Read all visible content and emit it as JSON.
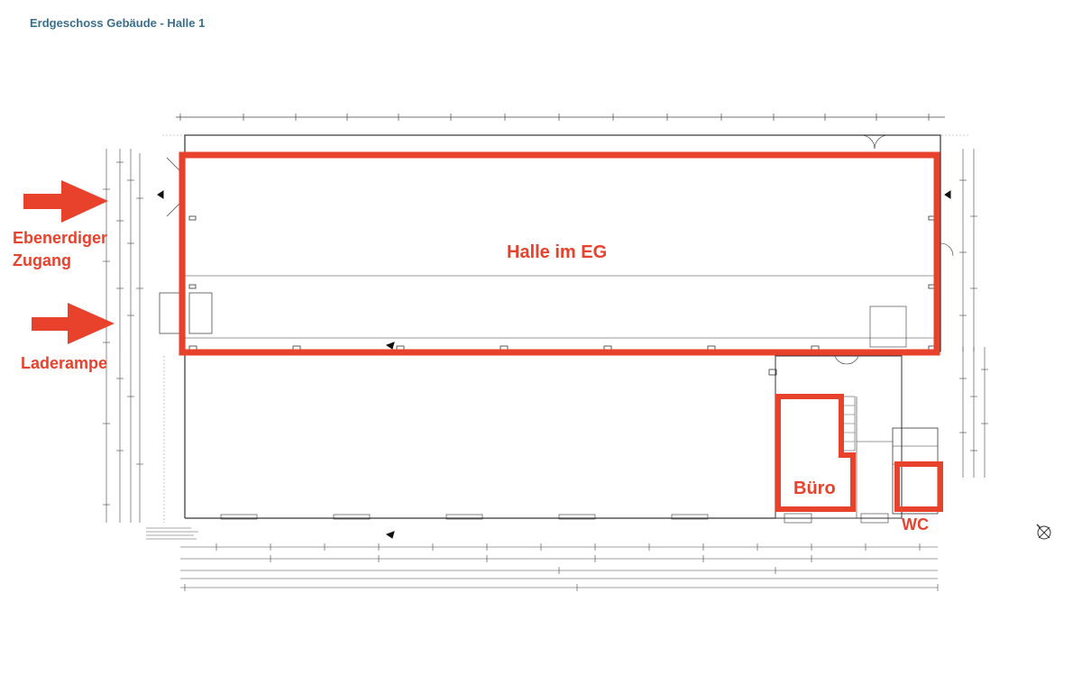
{
  "page": {
    "title": "Erdgeschoss Gebäude - Halle 1"
  },
  "annotations": {
    "halle": "Halle im EG",
    "buero": "Büro",
    "wc": "WC",
    "zugang_line1": "Ebenerdiger",
    "zugang_line2": "Zugang",
    "laderampe": "Laderampe"
  },
  "colors": {
    "highlight": "#e8412c",
    "title": "#3a6e8c",
    "drawing": "#333333"
  },
  "icons": {
    "north_arrow": "compass-north-icon"
  }
}
